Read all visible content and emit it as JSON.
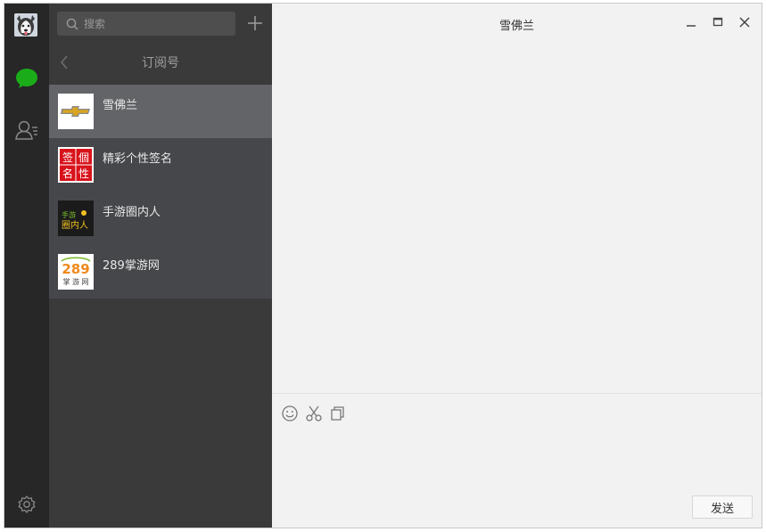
{
  "search": {
    "placeholder": "搜索"
  },
  "panel": {
    "header_title": "订阅号"
  },
  "subscriptions": [
    {
      "name": "雪佛兰",
      "active": true
    },
    {
      "name": "精彩个性签名",
      "active": false
    },
    {
      "name": "手游圈内人",
      "active": false
    },
    {
      "name": "289掌游网",
      "active": false
    }
  ],
  "thumbs": {
    "sign_chars": [
      "签",
      "個",
      "名",
      "性"
    ],
    "game_line1": "手游",
    "game_line2": "圈内人",
    "logo_289_top": "289",
    "logo_289_bottom": "掌 游 网"
  },
  "chat": {
    "title": "雪佛兰",
    "send_label": "发送"
  },
  "colors": {
    "accent_green": "#1aad19",
    "rail": "#272727",
    "panel": "#3a3a3a",
    "active_item": "#636467"
  },
  "icons": {
    "rail": [
      "chat-icon",
      "contacts-icon",
      "settings-icon"
    ],
    "toolbar": [
      "emoji-icon",
      "scissors-icon",
      "copy-icon"
    ],
    "window": [
      "minimize-icon",
      "maximize-icon",
      "close-icon"
    ]
  }
}
